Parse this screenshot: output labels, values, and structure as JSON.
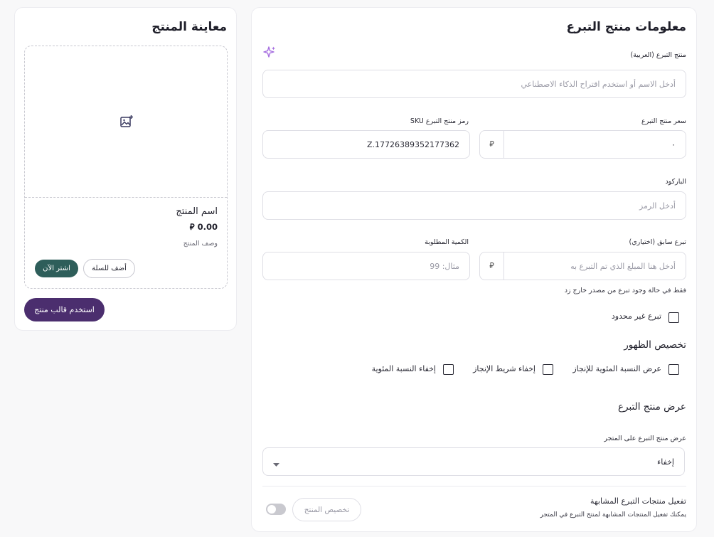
{
  "form": {
    "title": "معلومات منتج التبرع",
    "name_label": "منتج التبرع (العربية)",
    "name_placeholder": "أدخل الاسم أو استخدم اقتراح الذكاء الاصطناعي",
    "price_label": "سعر منتج التبرع",
    "price_value": "٠",
    "currency_symbol": "⃁",
    "sku_label": "رمز منتج التبرع SKU",
    "sku_value": "Z.17726389352177362",
    "barcode_label": "الباركود",
    "barcode_placeholder": "أدخل الرمز",
    "prev_donation_label": "تبرع سابق (اختياري)",
    "prev_donation_placeholder": "أدخل هنا المبلغ الذي تم التبرع به",
    "required_qty_label": "الكمية المطلوبة",
    "required_qty_placeholder": "مثال: 99",
    "prev_donation_hint": "فقط في حالة وجود تبرع من مصدر خارج زد",
    "unlimited_label": "تبرع غير محدود",
    "visibility_title": "تخصيص الظهور",
    "visibility_options": [
      "عرض النسبة المئوية للإنجاز",
      "إخفاء شريط الإنجاز",
      "إخفاء النسبة المئوية"
    ],
    "display_title": "عرض منتج التبرع",
    "display_store_label": "عرض منتج التبرع على المتجر",
    "display_store_value": "إخفاء",
    "similar_title": "تفعيل منتجات التبرع المشابهة",
    "similar_desc": "يمكنك تفعيل المنتجات المشابهة لمنتج التبرع في المتجر",
    "customize_product_button": "تخصيص المنتج"
  },
  "preview": {
    "title": "معاينة المنتج",
    "product_name": "اسم المنتج",
    "price": "0.00",
    "currency_symbol": "⃁",
    "description": "وصف المنتج",
    "add_to_cart": "أضف للسلة",
    "buy_now": "اشتر الآن",
    "use_template": "استخدم قالب منتج"
  },
  "colors": {
    "primary_purple": "#4b2e6e",
    "buy_now_teal": "#2e5e5a",
    "ai_sparkle": "#a66ee0"
  }
}
